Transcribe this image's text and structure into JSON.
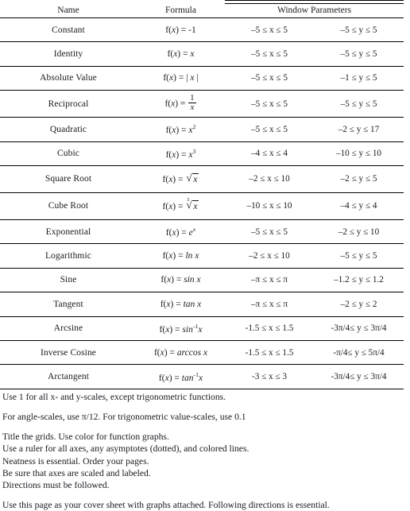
{
  "table": {
    "headers": {
      "name": "Name",
      "formula": "Formula",
      "window": "Window Parameters"
    },
    "rows": [
      {
        "name": "Constant",
        "formula_plain": "f(x) = -1",
        "x_window": "–5 ≤ x ≤ 5",
        "y_window": "–5 ≤ y ≤ 5"
      },
      {
        "name": "Identity",
        "formula_plain": "f(x) = x",
        "x_window": "–5 ≤ x ≤ 5",
        "y_window": "–5 ≤ y ≤ 5"
      },
      {
        "name": "Absolute Value",
        "formula_plain": "f(x) = | x |",
        "x_window": "–5 ≤ x ≤ 5",
        "y_window": "–1 ≤ y ≤ 5"
      },
      {
        "name": "Reciprocal",
        "formula_plain": "f(x) = 1/x",
        "x_window": "–5 ≤ x ≤ 5",
        "y_window": "–5 ≤ y ≤ 5"
      },
      {
        "name": "Quadratic",
        "formula_plain": "f(x) = x²",
        "x_window": "–5 ≤ x ≤ 5",
        "y_window": "–2 ≤ y ≤ 17"
      },
      {
        "name": "Cubic",
        "formula_plain": "f(x) = x³",
        "x_window": "–4 ≤ x ≤ 4",
        "y_window": "–10 ≤ y ≤ 10"
      },
      {
        "name": "Square Root",
        "formula_plain": "f(x) = √x",
        "x_window": "–2 ≤ x ≤ 10",
        "y_window": "–2 ≤ y ≤ 5"
      },
      {
        "name": "Cube Root",
        "formula_plain": "f(x) = ∛ x",
        "x_window": "–10 ≤ x ≤ 10",
        "y_window": "–4 ≤ y ≤ 4"
      },
      {
        "name": "Exponential",
        "formula_plain": "f(x) = eˣ",
        "x_window": "–5 ≤ x ≤ 5",
        "y_window": "–2 ≤ y ≤ 10"
      },
      {
        "name": "Logarithmic",
        "formula_plain": "f(x) = ln x",
        "x_window": "–2 ≤ x ≤ 10",
        "y_window": "–5 ≤ y ≤ 5"
      },
      {
        "name": "Sine",
        "formula_plain": "f(x) = sin x",
        "x_window": "–π ≤ x ≤ π",
        "y_window": "–1.2 ≤ y ≤ 1.2"
      },
      {
        "name": "Tangent",
        "formula_plain": "f(x) = tan x",
        "x_window": "–π ≤ x ≤ π",
        "y_window": "–2 ≤ y ≤ 2"
      },
      {
        "name": "Arcsine",
        "formula_plain": "f(x) = sin⁻¹x",
        "x_window": "-1.5 ≤ x ≤ 1.5",
        "y_window": "-3π/4≤ y ≤ 3π/4"
      },
      {
        "name": "Inverse Cosine",
        "formula_plain": "f(x) = arccos x",
        "x_window": "-1.5 ≤ x ≤ 1.5",
        "y_window": "-π/4≤ y ≤ 5π/4"
      },
      {
        "name": "Arctangent",
        "formula_plain": "f(x) = tan⁻¹x",
        "x_window": "-3 ≤ x ≤ 3",
        "y_window": "-3π/4≤ y ≤ 3π/4"
      }
    ]
  },
  "notes": [
    "Use 1 for all x- and y-scales, except trigonometric functions.",
    "For angle-scales, use π/12. For trigonometric value-scales, use 0.1",
    "Title the grids. Use color for function graphs.",
    "Use a ruler for all axes, any asymptotes (dotted), and colored lines.",
    "Neatness is essential. Order your pages.",
    "Be sure that axes are scaled and labeled.",
    "Directions must be followed.",
    "Use this page as your cover sheet with graphs attached. Following directions is essential."
  ]
}
